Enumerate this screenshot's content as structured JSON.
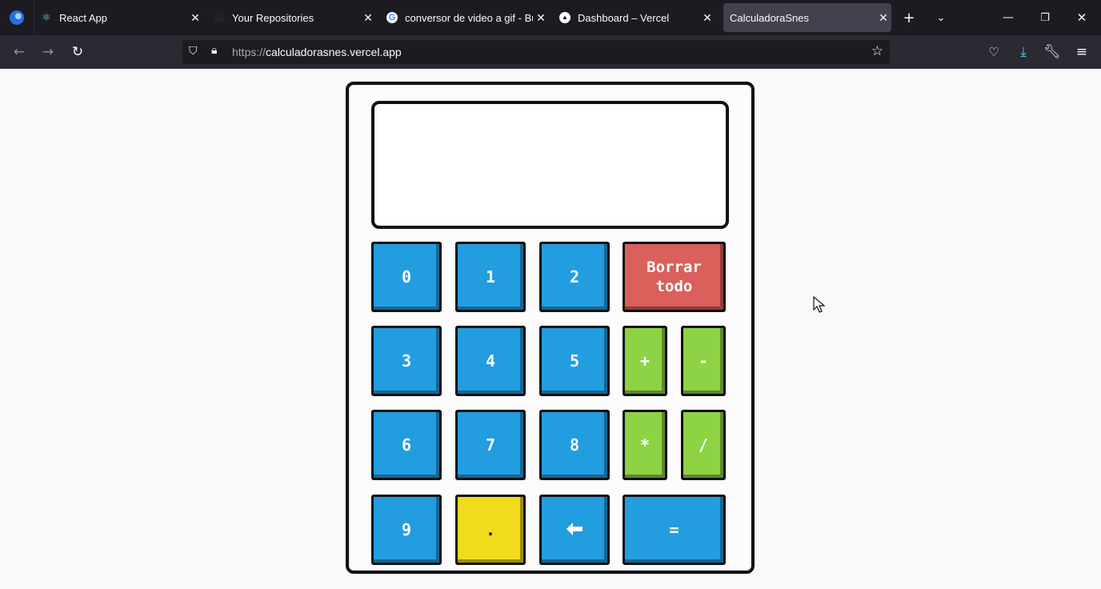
{
  "browser": {
    "tabs": [
      {
        "title": "React App",
        "icon": "react-icon"
      },
      {
        "title": "Your Repositories",
        "icon": "github-icon"
      },
      {
        "title": "conversor de video a gif - Bus",
        "icon": "google-icon"
      },
      {
        "title": "Dashboard – Vercel",
        "icon": "vercel-icon"
      },
      {
        "title": "CalculadoraSnes",
        "icon": "none",
        "active": true
      }
    ],
    "url_protocol": "https://",
    "url_host": "calculadorasnes.vercel.app"
  },
  "calculator": {
    "display": "",
    "keys": {
      "k0": "0",
      "k1": "1",
      "k2": "2",
      "clear_line1": "Borrar",
      "clear_line2": "todo",
      "k3": "3",
      "k4": "4",
      "k5": "5",
      "plus": "+",
      "minus": "-",
      "k6": "6",
      "k7": "7",
      "k8": "8",
      "multiply": "*",
      "divide": "/",
      "k9": "9",
      "dot": ".",
      "backspace": "🡐",
      "equals": "="
    },
    "colors": {
      "number": "#229de0",
      "clear": "#db5f5a",
      "operator": "#8ed344",
      "dot": "#f2da1c"
    }
  }
}
